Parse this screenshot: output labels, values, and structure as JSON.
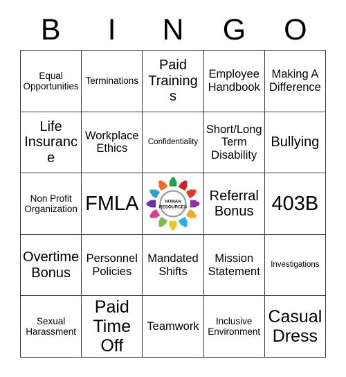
{
  "header": {
    "letters": [
      "B",
      "I",
      "N",
      "G",
      "O"
    ]
  },
  "grid": {
    "rows": 5,
    "columns": 5,
    "border_color": "#3a3a3a",
    "background_color": "#ffffff",
    "cells": [
      {
        "text": "Equal Opportunities",
        "size": "sm"
      },
      {
        "text": "Terminations",
        "size": "sm"
      },
      {
        "text": "Paid Trainings",
        "size": "lg"
      },
      {
        "text": "Employee Handbook",
        "size": "md"
      },
      {
        "text": "Making A Difference",
        "size": "md"
      },
      {
        "text": "Life Insurance",
        "size": "lg"
      },
      {
        "text": "Workplace Ethics",
        "size": "md"
      },
      {
        "text": "Confidentiality",
        "size": "xs"
      },
      {
        "text": "Short/Long Term Disability",
        "size": "md"
      },
      {
        "text": "Bullying",
        "size": "lg"
      },
      {
        "text": "Non Profit Organization",
        "size": "sm"
      },
      {
        "text": "FMLA",
        "size": "xxl"
      },
      {
        "text": "",
        "size": "md",
        "type": "logo"
      },
      {
        "text": "Referral Bonus",
        "size": "lg"
      },
      {
        "text": "403B",
        "size": "xxl"
      },
      {
        "text": "Overtime Bonus",
        "size": "lg"
      },
      {
        "text": "Personnel Policies",
        "size": "md"
      },
      {
        "text": "Mandated Shifts",
        "size": "md"
      },
      {
        "text": "Mission Statement",
        "size": "md"
      },
      {
        "text": "Investigations",
        "size": "xs"
      },
      {
        "text": "Sexual Harassment",
        "size": "sm"
      },
      {
        "text": "Paid Time Off",
        "size": "xl"
      },
      {
        "text": "Teamwork",
        "size": "md"
      },
      {
        "text": "Inclusive Environment",
        "size": "sm"
      },
      {
        "text": "Casual Dress",
        "size": "xl"
      }
    ]
  },
  "logo": {
    "name": "human-resources-logo",
    "caption_line_1": "HUMAN",
    "caption_line_2": "RESOURCES",
    "ring_color": "#9b9b9b",
    "figure_colors": [
      "#1aa64b",
      "#d81f26",
      "#e8332a",
      "#8e2fb0",
      "#f5a623",
      "#27b0e6",
      "#f0c419",
      "#7ac143",
      "#e23b8c",
      "#6a2fa0",
      "#2ba6cb",
      "#f26522"
    ]
  }
}
